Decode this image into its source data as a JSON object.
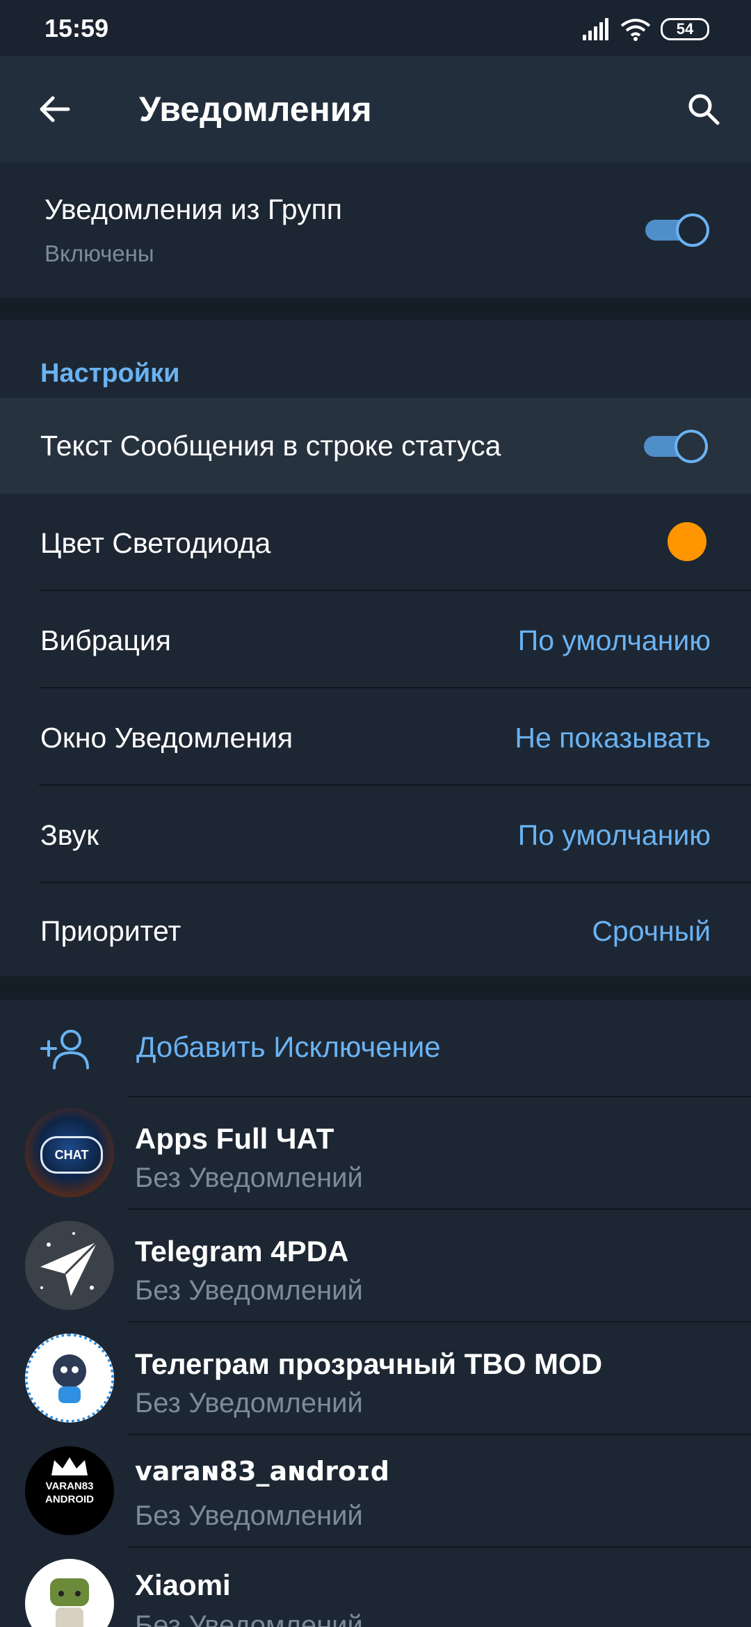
{
  "status_bar": {
    "time": "15:59",
    "battery": "54",
    "icons": [
      "signal-icon",
      "wifi-icon",
      "battery-icon"
    ]
  },
  "app_bar": {
    "title": "Уведомления",
    "back_icon": "arrow-left-icon",
    "search_icon": "search-icon"
  },
  "group_notifications": {
    "title": "Уведомления из Групп",
    "subtitle": "Включены",
    "enabled": true
  },
  "settings": {
    "header": "Настройки",
    "status_bar_text": {
      "label": "Текст Сообщения в строке статуса",
      "enabled": true
    },
    "led_color": {
      "label": "Цвет Светодиода",
      "color": "#ff9500"
    },
    "vibration": {
      "label": "Вибрация",
      "value": "По умолчанию"
    },
    "popup": {
      "label": "Окно Уведомления",
      "value": "Не показывать"
    },
    "sound": {
      "label": "Звук",
      "value": "По умолчанию"
    },
    "priority": {
      "label": "Приоритет",
      "value": "Срочный"
    }
  },
  "exceptions": {
    "add_label": "Добавить Исключение",
    "items": [
      {
        "name": "Apps Full ЧАТ",
        "status": "Без Уведомлений",
        "avatar_text": "CHAT"
      },
      {
        "name": "Telegram 4PDA",
        "status": "Без Уведомлений"
      },
      {
        "name": "Телеграм прозрачный TBO MOD",
        "status": "Без Уведомлений"
      },
      {
        "name": "varaɴ83_aɴdroɪd",
        "status": "Без Уведомлений",
        "avatar_text": "VARAN83 ANDROID"
      },
      {
        "name": "Xiaomi",
        "status": "Без Уведомлений"
      }
    ]
  },
  "colors": {
    "accent": "#6ab3f3",
    "background": "#1d2733",
    "header": "#232e3c",
    "led": "#ff9500"
  }
}
